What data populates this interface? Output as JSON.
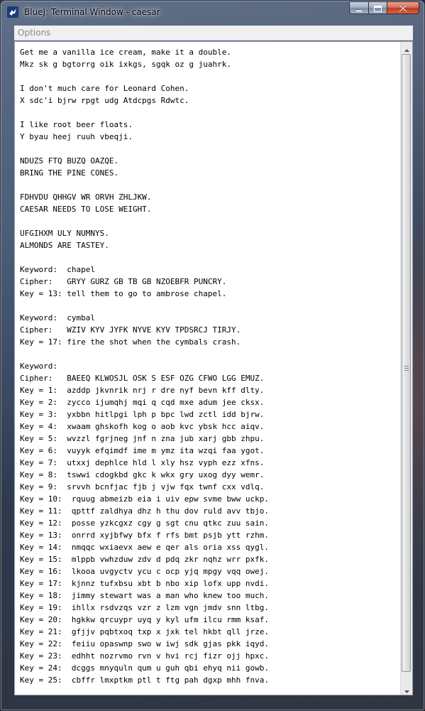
{
  "window": {
    "title": "BlueJ: Terminal Window - caesar",
    "icons": {
      "app": "bluej-bird-icon",
      "minimize": "minimize-icon",
      "maximize": "maximize-icon",
      "close": "close-icon"
    }
  },
  "menubar": {
    "options_label": "Options"
  },
  "terminal": {
    "lines": [
      "Get me a vanilla ice cream, make it a double.",
      "Mkz sk g bgtorrg oik ixkgs, sgqk oz g juahrk.",
      "",
      "I don't much care for Leonard Cohen.",
      "X sdc'i bjrw rpgt udg Atdcpgs Rdwtc.",
      "",
      "I like root beer floats.",
      "Y byau heej ruuh vbeqji.",
      "",
      "NDUZS FTQ BUZQ OAZQE.",
      "BRING THE PINE CONES.",
      "",
      "FDHVDU QHHGV WR ORVH ZHLJKW.",
      "CAESAR NEEDS TO LOSE WEIGHT.",
      "",
      "UFGIHXM ULY NUMNYS.",
      "ALMONDS ARE TASTEY.",
      "",
      "Keyword:  chapel",
      "Cipher:   GRYY GURZ GB TB GB NZOEBFR PUNCRY.",
      "Key = 13: tell them to go to ambrose chapel.",
      "",
      "Keyword:  cymbal",
      "Cipher:   WZIV KYV JYFK NYVE KYV TPDSRCJ TIRJY.",
      "Key = 17: fire the shot when the cymbals crash.",
      "",
      "Keyword:",
      "Cipher:   BAEEQ KLWOSJL OSK S ESF OZG CFWO LGG EMUZ.",
      "Key = 1:  azddp jkvnrik nrj r dre nyf bevn kff dlty.",
      "Key = 2:  zycco ijumqhj mqi q cqd mxe adum jee cksx.",
      "Key = 3:  yxbbn hitlpgi lph p bpc lwd zctl idd bjrw.",
      "Key = 4:  xwaam ghskofh kog o aob kvc ybsk hcc aiqv.",
      "Key = 5:  wvzzl fgrjneg jnf n zna jub xarj gbb zhpu.",
      "Key = 6:  vuyyk efqimdf ime m ymz ita wzqi faa ygot.",
      "Key = 7:  utxxj dephlce hld l xly hsz vyph ezz xfns.",
      "Key = 8:  tswwi cdogkbd gkc k wkx gry uxog dyy wemr.",
      "Key = 9:  srvvh bcnfjac fjb j vjw fqx twnf cxx vdlq.",
      "Key = 10:  rquug abmeizb eia i uiv epw svme bww uckp.",
      "Key = 11:  qpttf zaldhya dhz h thu dov ruld avv tbjo.",
      "Key = 12:  posse yzkcgxz cgy g sgt cnu qtkc zuu sain.",
      "Key = 13:  onrrd xyjbfwy bfx f rfs bmt psjb ytt rzhm.",
      "Key = 14:  nmqqc wxiaevx aew e qer als oria xss qygl.",
      "Key = 15:  mlppb vwhzduw zdv d pdq zkr nqhz wrr pxfk.",
      "Key = 16:  lkooa uvgyctv ycu c ocp yjq mpgy vqq owej.",
      "Key = 17:  kjnnz tufxbsu xbt b nbo xip lofx upp nvdi.",
      "Key = 18:  jimmy stewart was a man who knew too much.",
      "Key = 19:  ihllx rsdvzqs vzr z lzm vgn jmdv snn ltbg.",
      "Key = 20:  hgkkw qrcuypr uyq y kyl ufm ilcu rmm ksaf.",
      "Key = 21:  gfjjv pqbtxoq txp x jxk tel hkbt qll jrze.",
      "Key = 22:  feiiu opaswnp swo w iwj sdk gjas pkk iqyd.",
      "Key = 23:  edhht nozrvmo rvn v hvi rcj fizr ojj hpxc.",
      "Key = 24:  dcggs mnyquln qum u guh qbi ehyq nii gowb.",
      "Key = 25:  cbffr lmxptkm ptl t ftg pah dgxp mhh fnva."
    ]
  },
  "scrollbar": {
    "up_icon": "scroll-up-arrow-icon",
    "down_icon": "scroll-down-arrow-icon",
    "grip_icon": "scroll-grip-icon"
  }
}
